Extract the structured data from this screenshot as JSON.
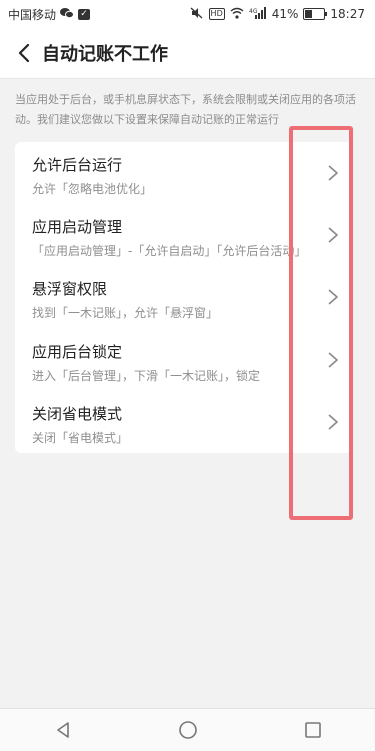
{
  "status_bar": {
    "carrier": "中国移动",
    "hd_badge": "HD",
    "signal_label": "4G",
    "battery": "41%",
    "battery_level": 0.41,
    "time": "18:27",
    "icons": [
      "wechat-icon",
      "app-notification-icon",
      "mute-icon",
      "hd-icon",
      "wifi-icon",
      "signal-icon",
      "battery-icon"
    ]
  },
  "header": {
    "title": "自动记账不工作",
    "back_icon": "back-arrow-icon"
  },
  "description": "当应用处于后台，或手机息屏状态下，系统会限制或关闭应用的各项活动。我们建议您做以下设置来保障自动记账的正常运行",
  "settings": [
    {
      "title": "允许后台运行",
      "subtitle": "允许「忽略电池优化」"
    },
    {
      "title": "应用启动管理",
      "subtitle": "「应用启动管理」-「允许自启动」「允许后台活动」"
    },
    {
      "title": "悬浮窗权限",
      "subtitle": "找到「一木记账」，允许「悬浮窗」"
    },
    {
      "title": "应用后台锁定",
      "subtitle": "进入「后台管理」，下滑「一木记账」，锁定"
    },
    {
      "title": "关闭省电模式",
      "subtitle": "关闭「省电模式」"
    }
  ],
  "colors": {
    "highlight": "#ee6e75",
    "background": "#f2f2f2",
    "card": "#ffffff"
  },
  "nav_bar": {
    "icons": [
      "back-triangle-icon",
      "home-circle-icon",
      "recents-square-icon"
    ]
  }
}
